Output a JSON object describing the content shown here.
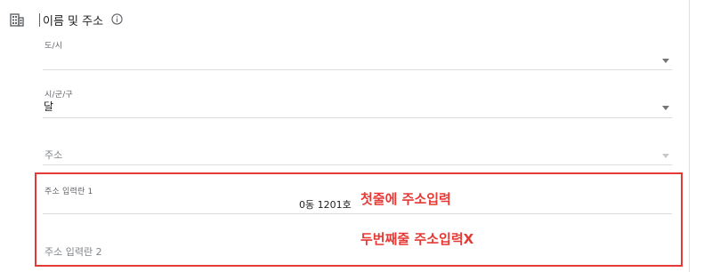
{
  "section": {
    "title": "이름 및 주소",
    "icon": "building-icon",
    "info_icon": "info-icon"
  },
  "fields": {
    "province": {
      "label": "도/시",
      "value": ""
    },
    "city": {
      "label": "시/군/구",
      "value": "달"
    },
    "address": {
      "placeholder": "주소"
    },
    "address_line1": {
      "label": "주소 입력란 1",
      "value": "0동 1201호"
    },
    "address_line2": {
      "placeholder": "주소 입력란 2"
    }
  },
  "annotations": {
    "first": "첫줄에 주소입력",
    "second": "두번째줄 주소입력X"
  },
  "colors": {
    "highlight": "#e53935",
    "divider": "#dadce0"
  }
}
